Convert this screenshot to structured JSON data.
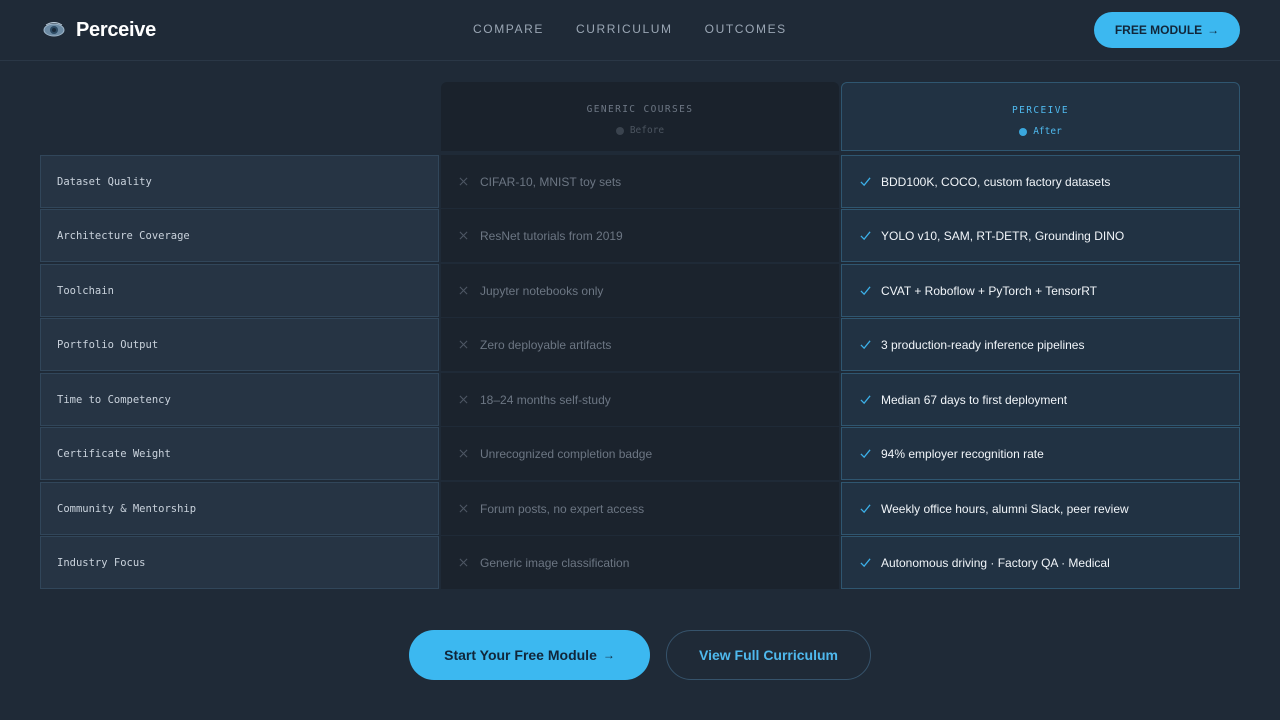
{
  "brand": {
    "name": "Perceive",
    "logo_icon": "eye-icon"
  },
  "nav": {
    "items": [
      "COMPARE",
      "CURRICULUM",
      "OUTCOMES"
    ]
  },
  "header_cta": {
    "label": "FREE MODULE",
    "arrow": "→"
  },
  "columns": {
    "generic": {
      "title": "GENERIC COURSES",
      "status": "Before"
    },
    "perceive": {
      "title": "PERCEIVE",
      "status": "After"
    }
  },
  "rows": [
    {
      "label": "Dataset Quality",
      "generic": "CIFAR-10, MNIST toy sets",
      "perceive": "BDD100K, COCO, custom factory datasets"
    },
    {
      "label": "Architecture Coverage",
      "generic": "ResNet tutorials from 2019",
      "perceive": "YOLO v10, SAM, RT-DETR, Grounding DINO"
    },
    {
      "label": "Toolchain",
      "generic": "Jupyter notebooks only",
      "perceive": "CVAT + Roboflow + PyTorch + TensorRT"
    },
    {
      "label": "Portfolio Output",
      "generic": "Zero deployable artifacts",
      "perceive": "3 production-ready inference pipelines"
    },
    {
      "label": "Time to Competency",
      "generic": "18–24 months self-study",
      "perceive": "Median 67 days to first deployment"
    },
    {
      "label": "Certificate Weight",
      "generic": "Unrecognized completion badge",
      "perceive": "94% employer recognition rate"
    },
    {
      "label": "Community & Mentorship",
      "generic": "Forum posts, no expert access",
      "perceive": "Weekly office hours, alumni Slack, peer review"
    },
    {
      "label": "Industry Focus",
      "generic": "Generic image classification",
      "perceive": "Autonomous driving · Factory QA · Medical"
    }
  ],
  "cta": {
    "primary": "Start Your Free Module",
    "primary_arrow": "→",
    "secondary": "View Full Curriculum"
  },
  "colors": {
    "background": "#1f2a37",
    "accent": "#3cb8f0",
    "perceive_cell": "#213243",
    "generic_cell": "#1b232d"
  }
}
